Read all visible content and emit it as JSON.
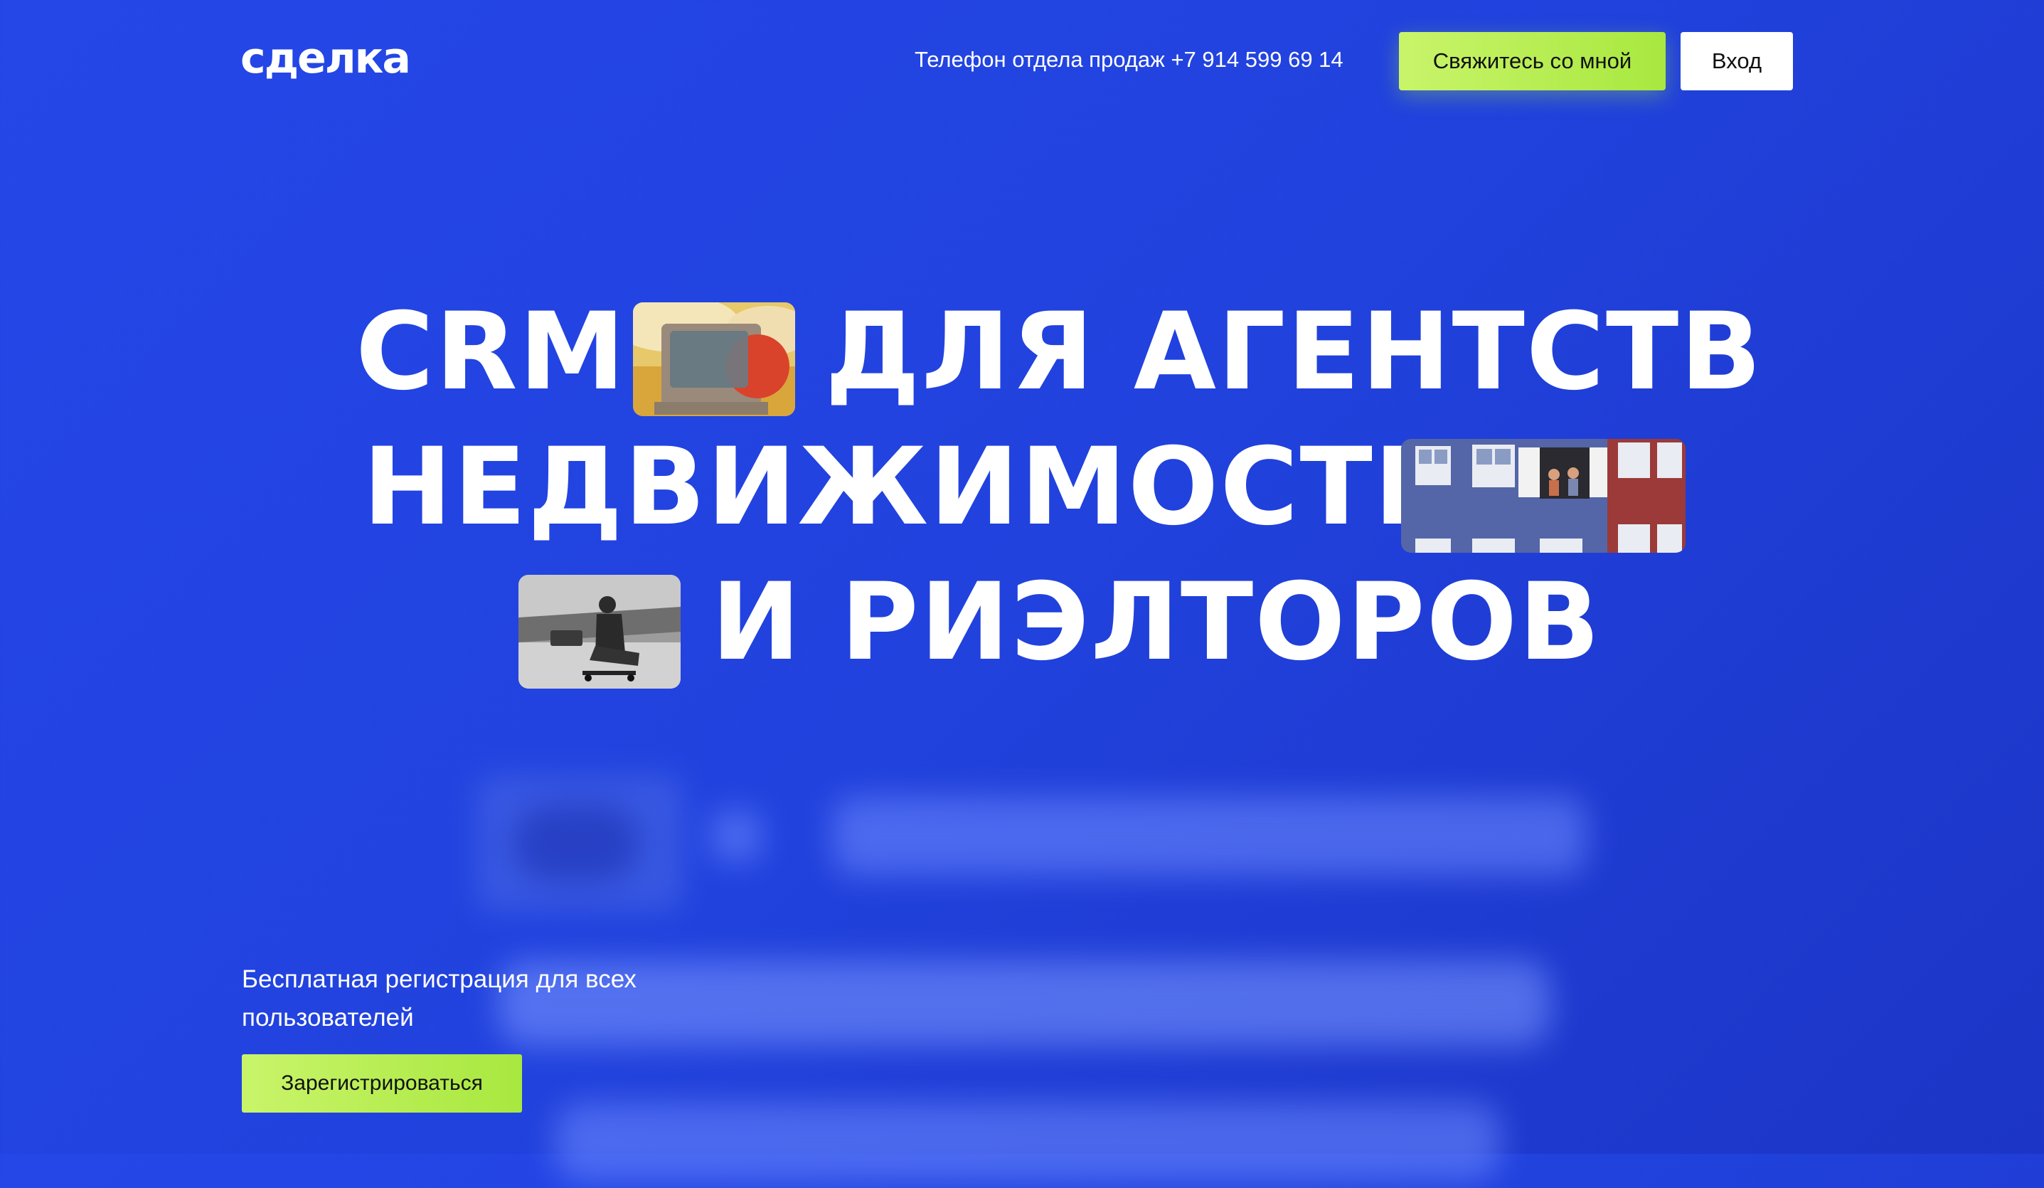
{
  "header": {
    "logo": "сделка",
    "phone": "Телефон отдела продаж +7 914 599 69 14",
    "contact_button": "Свяжитесь со мной",
    "login_button": "Вход"
  },
  "hero": {
    "line1_a": "CRM",
    "line1_b": "ДЛЯ АГЕНТСТВ",
    "line2": "НЕДВИЖИМОСТИ",
    "line3": "И РИЭЛТОРОВ"
  },
  "signup": {
    "text": "Бесплатная регистрация для всех пользователей",
    "button": "Зарегистрироваться"
  },
  "colors": {
    "background": "#2547e8",
    "accent": "#b5ee4f"
  }
}
